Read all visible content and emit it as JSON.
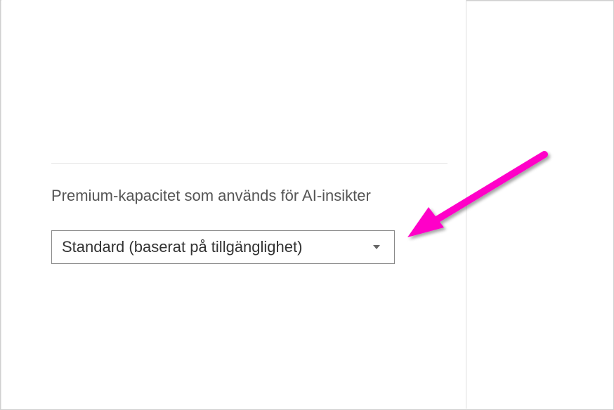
{
  "section": {
    "label": "Premium-kapacitet som används för AI-insikter"
  },
  "dropdown": {
    "selected": "Standard (baserat på tillgänglighet)"
  },
  "annotation": {
    "color": "#ff00c8"
  }
}
